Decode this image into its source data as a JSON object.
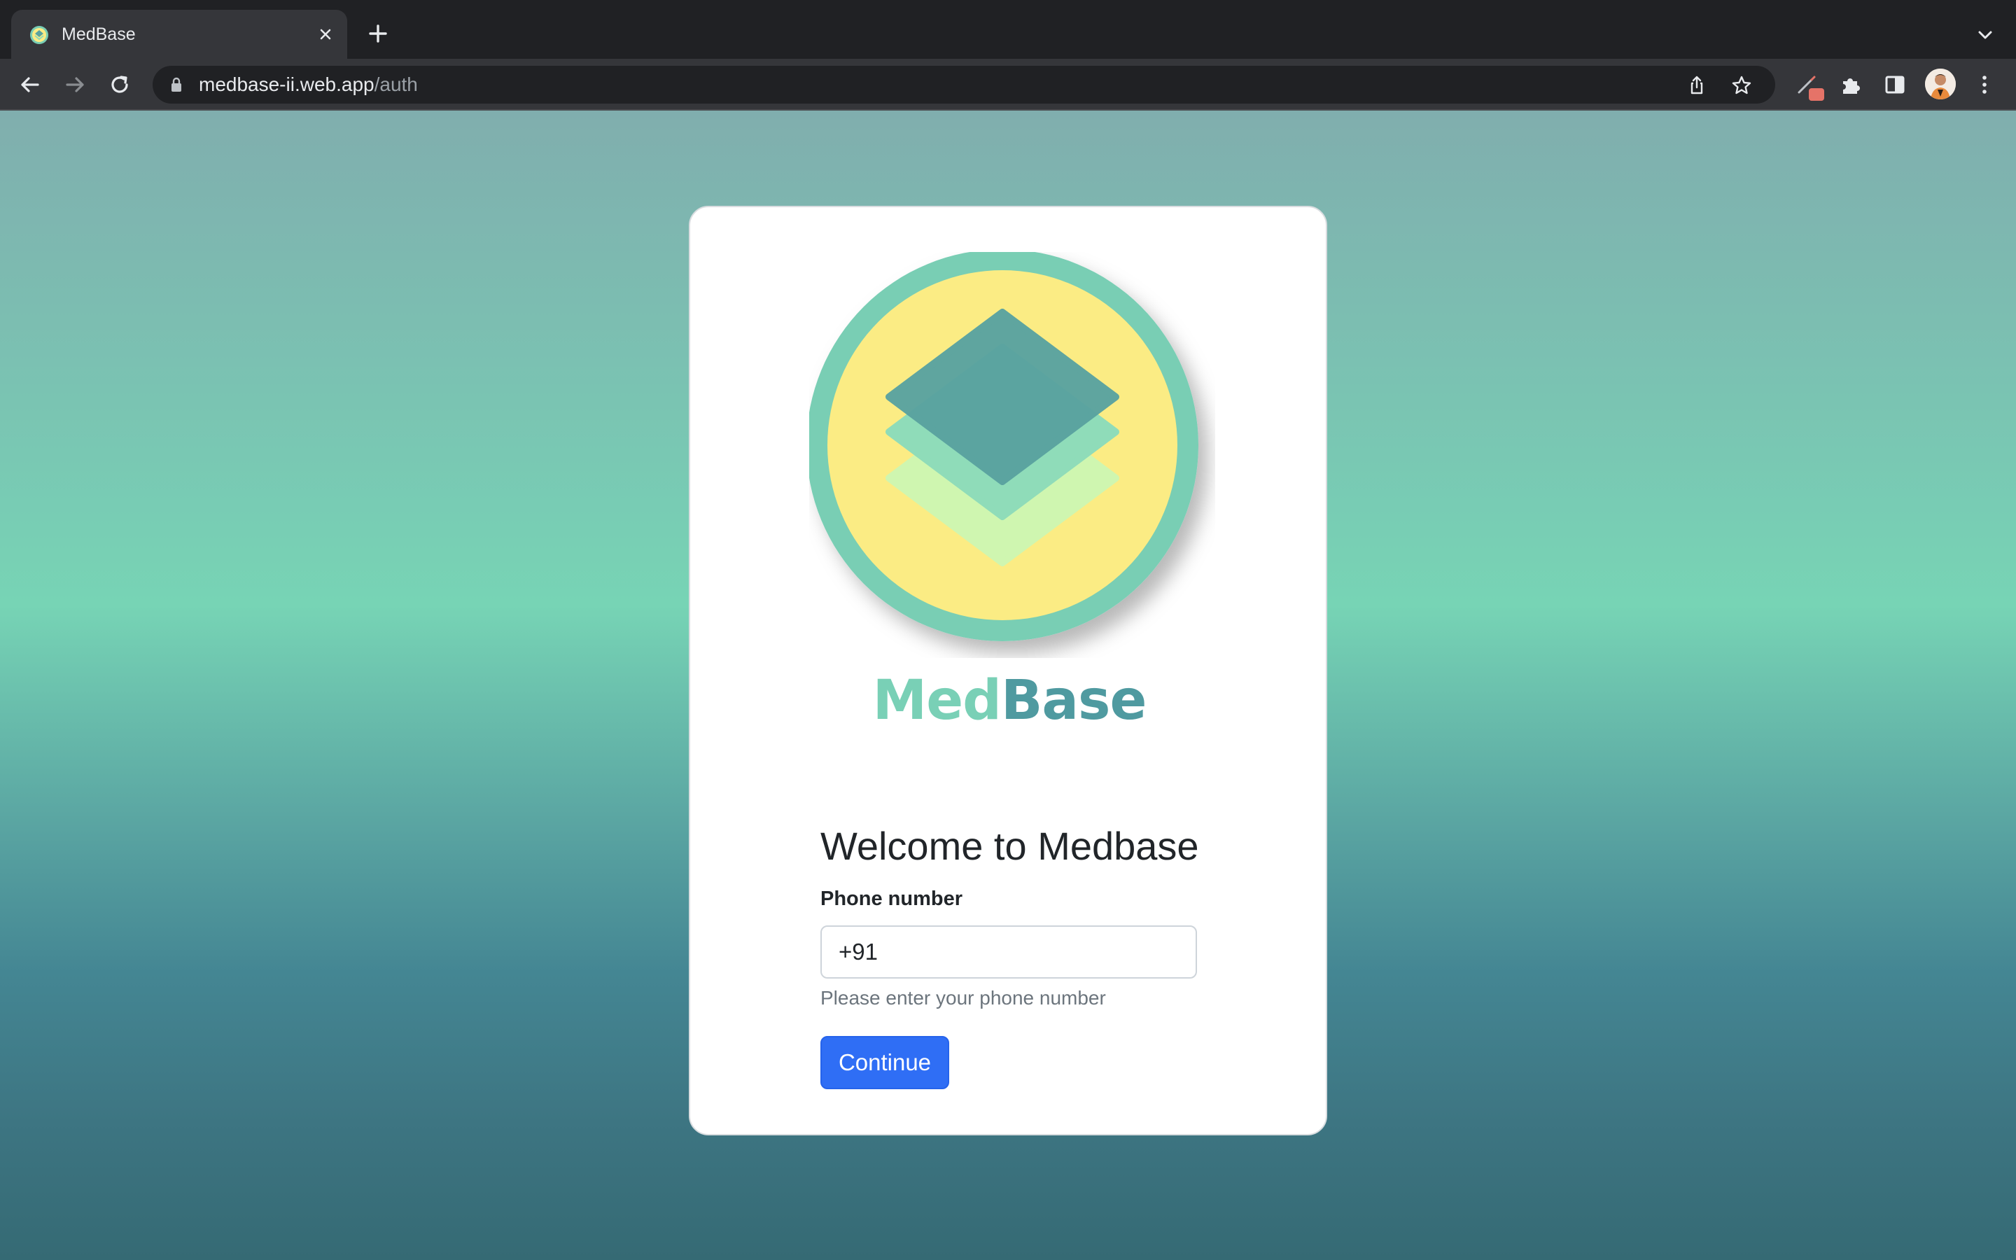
{
  "browser": {
    "tab": {
      "title": "MedBase",
      "favicon": "medbase-favicon",
      "close_icon": "close-icon"
    },
    "new_tab_icon": "plus-icon",
    "tab_search_icon": "chevron-down-icon",
    "nav": {
      "back_icon": "arrow-left-icon",
      "forward_icon": "arrow-right-icon",
      "reload_icon": "reload-icon"
    },
    "address": {
      "domain": "medbase-ii.web.app",
      "path": "/auth",
      "lock_icon": "lock-icon"
    },
    "omnibox_icons": [
      "share-icon",
      "star-icon"
    ],
    "extensions": [
      "pen-extension-icon",
      "puzzle-icon",
      "side-panel-icon"
    ],
    "menu_icon": "kebab-menu-icon"
  },
  "card": {
    "brand": {
      "part1": "Med",
      "part2": "Base"
    },
    "colors": {
      "brand_light": "#79d0b6",
      "brand_dark": "#4f9aa0",
      "logo_ring": "#79ceb4",
      "logo_inner": "#fbec84",
      "primary_button": "#2f6ef5"
    },
    "welcome_title": "Welcome to Medbase",
    "phone": {
      "label": "Phone number",
      "value": "+91",
      "hint": "Please enter your phone number"
    },
    "continue_label": "Continue"
  }
}
